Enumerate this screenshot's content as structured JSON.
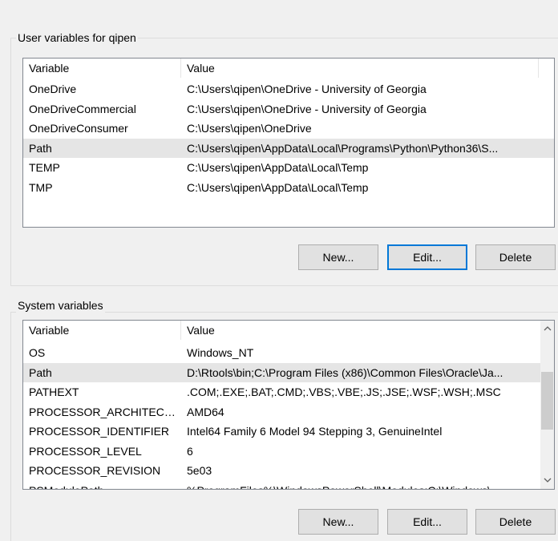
{
  "user_section": {
    "title": "User variables for qipen",
    "columns": [
      "Variable",
      "Value"
    ],
    "rows": [
      {
        "variable": "OneDrive",
        "value": "C:\\Users\\qipen\\OneDrive - University of Georgia"
      },
      {
        "variable": "OneDriveCommercial",
        "value": "C:\\Users\\qipen\\OneDrive - University of Georgia"
      },
      {
        "variable": "OneDriveConsumer",
        "value": "C:\\Users\\qipen\\OneDrive"
      },
      {
        "variable": "Path",
        "value": "C:\\Users\\qipen\\AppData\\Local\\Programs\\Python\\Python36\\S...",
        "selected": true
      },
      {
        "variable": "TEMP",
        "value": "C:\\Users\\qipen\\AppData\\Local\\Temp"
      },
      {
        "variable": "TMP",
        "value": "C:\\Users\\qipen\\AppData\\Local\\Temp"
      }
    ],
    "buttons": {
      "new": "New...",
      "edit": "Edit...",
      "delete": "Delete"
    }
  },
  "system_section": {
    "title": "System variables",
    "columns": [
      "Variable",
      "Value"
    ],
    "rows": [
      {
        "variable": "OS",
        "value": "Windows_NT"
      },
      {
        "variable": "Path",
        "value": "D:\\Rtools\\bin;C:\\Program Files (x86)\\Common Files\\Oracle\\Ja...",
        "selected": true
      },
      {
        "variable": "PATHEXT",
        "value": ".COM;.EXE;.BAT;.CMD;.VBS;.VBE;.JS;.JSE;.WSF;.WSH;.MSC"
      },
      {
        "variable": "PROCESSOR_ARCHITECTU...",
        "value": "AMD64"
      },
      {
        "variable": "PROCESSOR_IDENTIFIER",
        "value": "Intel64 Family 6 Model 94 Stepping 3, GenuineIntel"
      },
      {
        "variable": "PROCESSOR_LEVEL",
        "value": "6"
      },
      {
        "variable": "PROCESSOR_REVISION",
        "value": "5e03"
      },
      {
        "variable": "PSModulePath",
        "value": "%ProgramFiles%\\WindowsPowerShell\\Modules;C:\\Windows\\..."
      }
    ],
    "buttons": {
      "new": "New...",
      "edit": "Edit...",
      "delete": "Delete"
    },
    "scrollbar": {
      "up_icon": "chevron-up-icon",
      "down_icon": "chevron-down-icon"
    }
  }
}
